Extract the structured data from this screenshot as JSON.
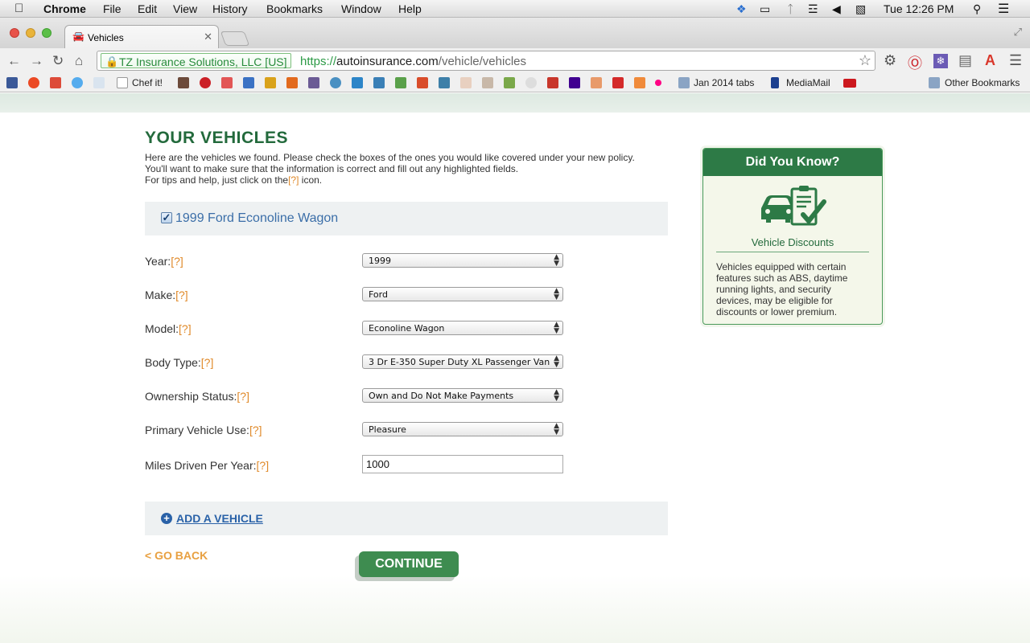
{
  "menubar": {
    "app": "Chrome",
    "items": [
      "File",
      "Edit",
      "View",
      "History",
      "Bookmarks",
      "Window",
      "Help"
    ],
    "clock": "Tue 12:26 PM"
  },
  "browser": {
    "tab_title": "Vehicles",
    "ev_cert": "TZ Insurance Solutions, LLC [US]",
    "url_scheme": "https://",
    "url_host": "autoinsurance.com",
    "url_path": "/vehicle/vehicles",
    "bookmarks": [
      "Chef it!",
      "Jan 2014 tabs",
      "MediaMail",
      "Other Bookmarks"
    ]
  },
  "page": {
    "title": "YOUR VEHICLES",
    "intro_line1": "Here are the vehicles we found. Please check the boxes of the ones you would like covered under your new policy.",
    "intro_line2": "You'll want to make sure that the information is correct and fill out any highlighted fields.",
    "intro_line3a": "For tips and help, just click on the",
    "help_marker": "[?]",
    "intro_line3b": " icon.",
    "vehicle": {
      "checked": true,
      "name": "1999 Ford Econoline Wagon"
    },
    "fields": [
      {
        "label": "Year:",
        "value": "1999",
        "type": "select"
      },
      {
        "label": "Make:",
        "value": "Ford",
        "type": "select"
      },
      {
        "label": "Model:",
        "value": "Econoline Wagon",
        "type": "select"
      },
      {
        "label": "Body Type:",
        "value": "3 Dr E-350 Super Duty XL Passenger Van",
        "type": "select"
      },
      {
        "label": "Ownership Status:",
        "value": "Own and Do Not Make Payments",
        "type": "select"
      },
      {
        "label": "Primary Vehicle Use:",
        "value": "Pleasure",
        "type": "select"
      },
      {
        "label": "Miles Driven Per Year:",
        "value": "1000",
        "type": "text"
      }
    ],
    "add_vehicle": "ADD A VEHICLE",
    "go_back": "< GO BACK",
    "continue": "CONTINUE"
  },
  "sidebar": {
    "heading": "Did You Know?",
    "subheading": "Vehicle Discounts",
    "text": "Vehicles equipped with certain features such as ABS, daytime running lights, and security devices, may be eligible for discounts or lower premium.",
    "icon": "car-clipboard-check-icon",
    "accent": "#2d7a46"
  }
}
